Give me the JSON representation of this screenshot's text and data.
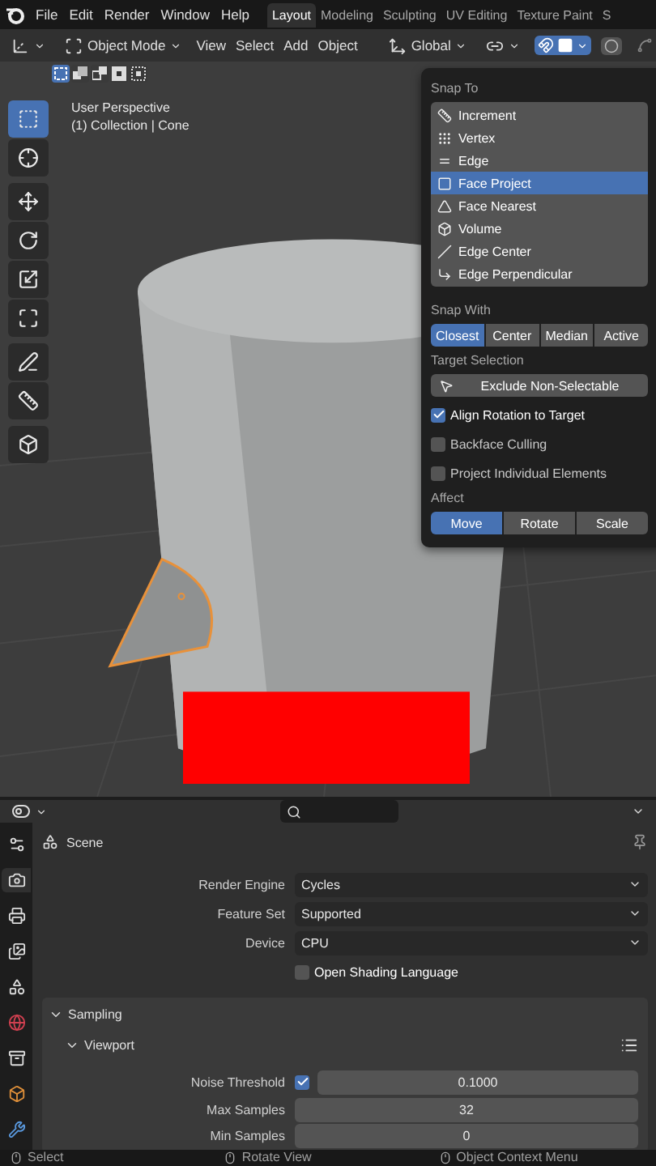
{
  "top_bar": {
    "menus": [
      "File",
      "Edit",
      "Render",
      "Window",
      "Help"
    ],
    "workspace_tabs": [
      {
        "label": "Layout",
        "selected": true
      },
      {
        "label": "Modeling",
        "selected": false
      },
      {
        "label": "Sculpting",
        "selected": false
      },
      {
        "label": "UV Editing",
        "selected": false
      },
      {
        "label": "Texture Paint",
        "selected": false
      },
      {
        "label": "S",
        "selected": false
      }
    ]
  },
  "header": {
    "mode": "Object Mode",
    "menus": [
      "View",
      "Select",
      "Add",
      "Object"
    ],
    "orientation": "Global",
    "snapping_on": true,
    "proportional_on": false
  },
  "selection_modes": [
    {
      "kind": "new",
      "selected": true
    },
    {
      "kind": "extend",
      "selected": false
    },
    {
      "kind": "subtract",
      "selected": false
    },
    {
      "kind": "invert",
      "selected": false
    },
    {
      "kind": "intersect",
      "selected": false
    }
  ],
  "toolbar": [
    [
      {
        "kind": "select-box",
        "selected": true
      },
      {
        "kind": "cursor",
        "selected": false
      }
    ],
    [
      {
        "kind": "move",
        "selected": false
      },
      {
        "kind": "rotate",
        "selected": false
      },
      {
        "kind": "scale",
        "selected": false
      },
      {
        "kind": "transform",
        "selected": false
      }
    ],
    [
      {
        "kind": "annotate",
        "selected": false
      },
      {
        "kind": "measure",
        "selected": false
      }
    ],
    [
      {
        "kind": "add-cube",
        "selected": false
      }
    ]
  ],
  "viewport": {
    "overlay_lines": [
      "User Perspective",
      "(1) Collection | Cone"
    ]
  },
  "snap_popup": {
    "snap_to_title": "Snap To",
    "snap_to": [
      {
        "label": "Increment",
        "kind": "increment",
        "selected": false
      },
      {
        "label": "Vertex",
        "kind": "vertex",
        "selected": false
      },
      {
        "label": "Edge",
        "kind": "edge",
        "selected": false
      },
      {
        "label": "Face Project",
        "kind": "face-project",
        "selected": true
      },
      {
        "label": "Face Nearest",
        "kind": "face-nearest",
        "selected": false
      },
      {
        "label": "Volume",
        "kind": "volume",
        "selected": false
      },
      {
        "label": "Edge Center",
        "kind": "edge-center",
        "selected": false
      },
      {
        "label": "Edge Perpendicular",
        "kind": "edge-perpendicular",
        "selected": false
      }
    ],
    "snap_with_title": "Snap With",
    "snap_with": [
      {
        "label": "Closest",
        "selected": true
      },
      {
        "label": "Center",
        "selected": false
      },
      {
        "label": "Median",
        "selected": false
      },
      {
        "label": "Active",
        "selected": false
      }
    ],
    "target_selection_title": "Target Selection",
    "exclude_button": "Exclude Non-Selectable",
    "options": [
      {
        "label": "Align Rotation to Target",
        "checked": true
      },
      {
        "label": "Backface Culling",
        "checked": false
      },
      {
        "label": "Project Individual Elements",
        "checked": false
      }
    ],
    "affect_title": "Affect",
    "affect": [
      {
        "label": "Move",
        "selected": true
      },
      {
        "label": "Rotate",
        "selected": false
      },
      {
        "label": "Scale",
        "selected": false
      }
    ]
  },
  "properties": {
    "breadcrumb": "Scene",
    "tabs": [
      {
        "kind": "tool",
        "selected": false
      },
      {
        "kind": "render",
        "selected": true
      },
      {
        "kind": "output",
        "selected": false
      },
      {
        "kind": "view-layer",
        "selected": false
      },
      {
        "kind": "scene",
        "selected": false
      },
      {
        "kind": "world",
        "selected": false
      },
      {
        "kind": "collection",
        "selected": false
      },
      {
        "kind": "object",
        "selected": false
      },
      {
        "kind": "modifier",
        "selected": false
      }
    ],
    "fields": [
      {
        "label": "Render Engine",
        "value": "Cycles"
      },
      {
        "label": "Feature Set",
        "value": "Supported"
      },
      {
        "label": "Device",
        "value": "CPU"
      }
    ],
    "osl": {
      "label": "Open Shading Language",
      "checked": false
    },
    "sampling": {
      "title": "Sampling",
      "expanded": true,
      "viewport": {
        "title": "Viewport",
        "expanded": true,
        "noise_threshold": {
          "label": "Noise Threshold",
          "checked": true,
          "value": "0.1000"
        },
        "rows": [
          {
            "label": "Max Samples",
            "value": "32"
          },
          {
            "label": "Min Samples",
            "value": "0"
          }
        ]
      }
    }
  },
  "status_bar": [
    "Select",
    "Rotate View",
    "Object Context Menu"
  ]
}
